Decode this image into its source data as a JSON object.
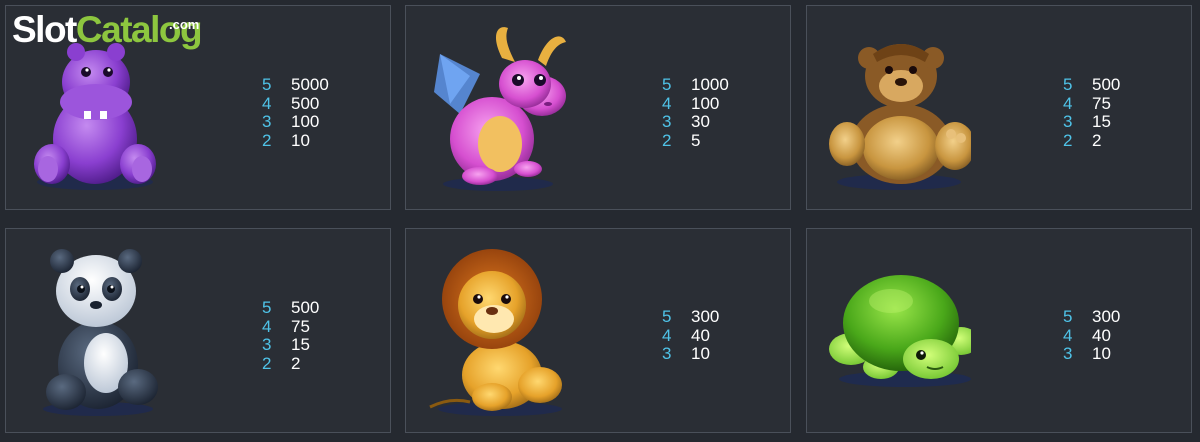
{
  "watermark": {
    "slot": "Slot",
    "catalog": "Catalog",
    "com": ".com"
  },
  "symbols": [
    {
      "icon": "purple-hippo-icon",
      "paytable": [
        {
          "count": "5",
          "payout": "5000"
        },
        {
          "count": "4",
          "payout": "500"
        },
        {
          "count": "3",
          "payout": "100"
        },
        {
          "count": "2",
          "payout": "10"
        }
      ]
    },
    {
      "icon": "pink-dragon-icon",
      "paytable": [
        {
          "count": "5",
          "payout": "1000"
        },
        {
          "count": "4",
          "payout": "100"
        },
        {
          "count": "3",
          "payout": "30"
        },
        {
          "count": "2",
          "payout": "5"
        }
      ]
    },
    {
      "icon": "teddy-bear-icon",
      "paytable": [
        {
          "count": "5",
          "payout": "500"
        },
        {
          "count": "4",
          "payout": "75"
        },
        {
          "count": "3",
          "payout": "15"
        },
        {
          "count": "2",
          "payout": "2"
        }
      ]
    },
    {
      "icon": "panda-icon",
      "paytable": [
        {
          "count": "5",
          "payout": "500"
        },
        {
          "count": "4",
          "payout": "75"
        },
        {
          "count": "3",
          "payout": "15"
        },
        {
          "count": "2",
          "payout": "2"
        }
      ]
    },
    {
      "icon": "lion-icon",
      "paytable": [
        {
          "count": "5",
          "payout": "300"
        },
        {
          "count": "4",
          "payout": "40"
        },
        {
          "count": "3",
          "payout": "10"
        }
      ]
    },
    {
      "icon": "turtle-icon",
      "paytable": [
        {
          "count": "5",
          "payout": "300"
        },
        {
          "count": "4",
          "payout": "40"
        },
        {
          "count": "3",
          "payout": "10"
        }
      ]
    }
  ],
  "colors": {
    "background": "#252930",
    "panel_border": "#4a505a",
    "count_text": "#4fc3e8",
    "payout_text": "#ffffff",
    "logo_green": "#8dc63f"
  }
}
